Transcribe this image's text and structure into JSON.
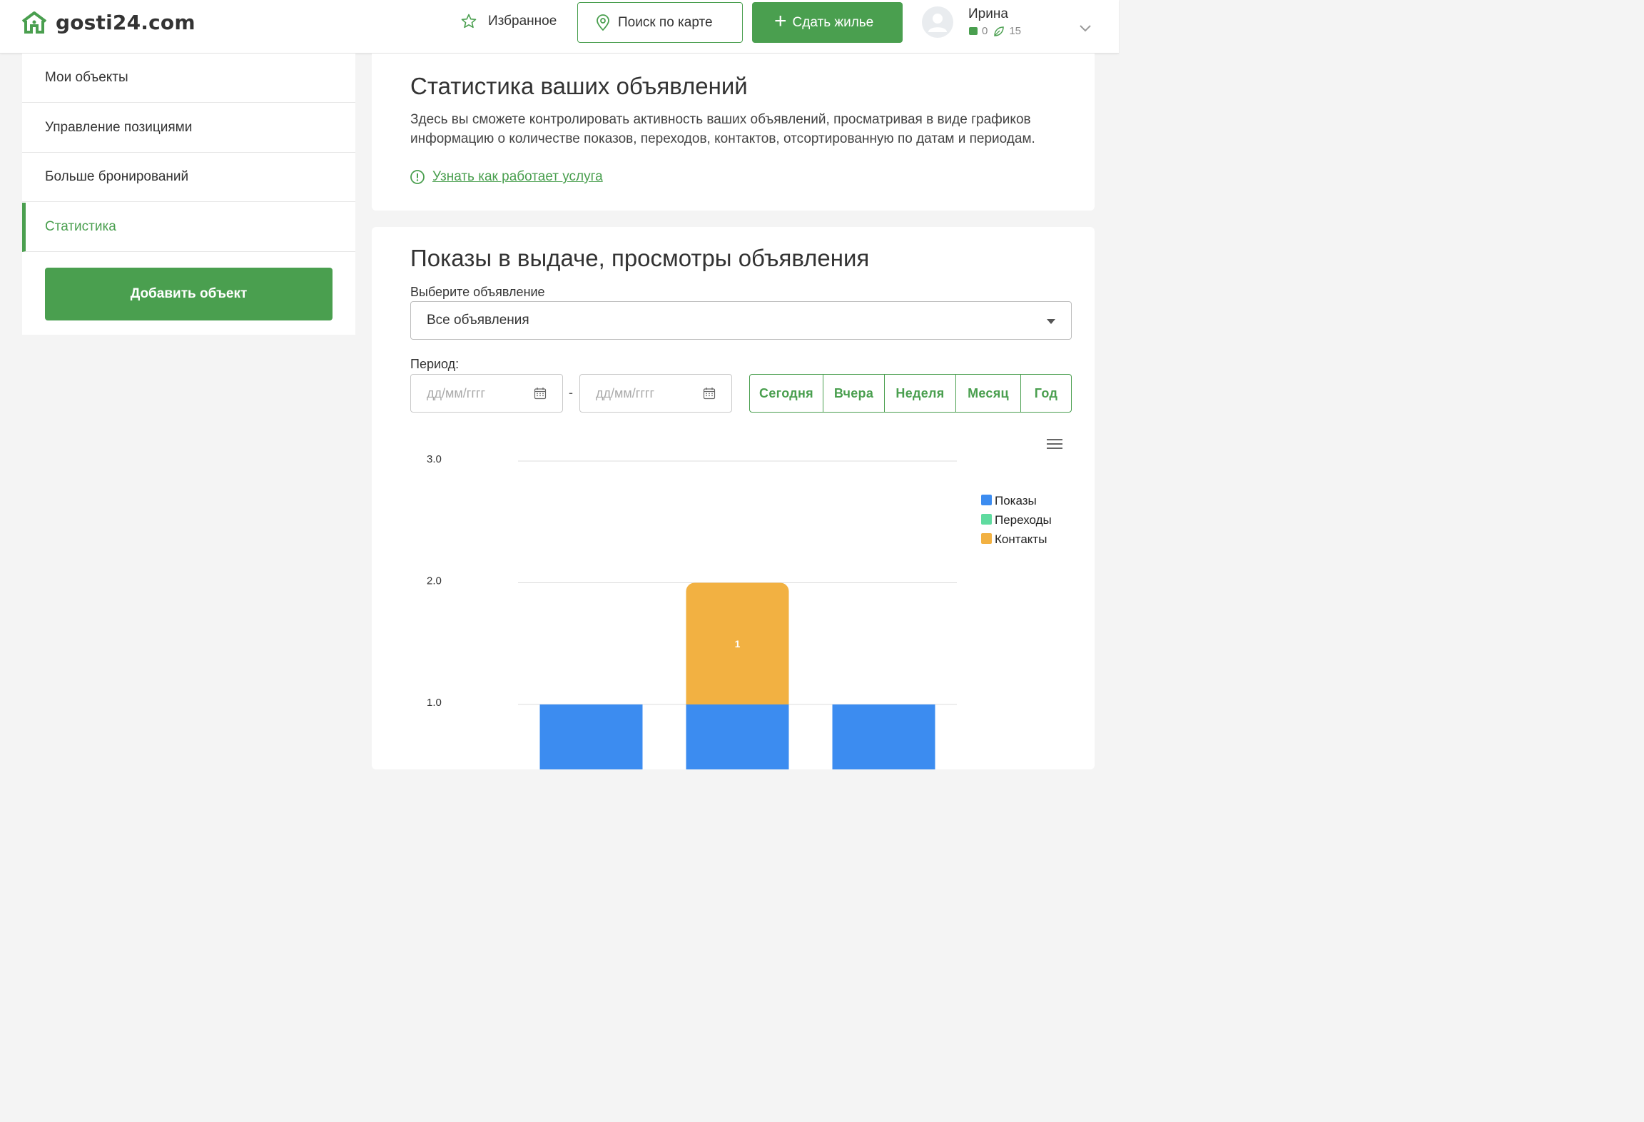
{
  "header": {
    "logo_text": "gosti24.com",
    "favorites_label": "Избранное",
    "map_search_label": "Поиск по карте",
    "rent_out_label": "Сдать жилье",
    "user": {
      "name": "Ирина",
      "count_a": "0",
      "count_b": "15"
    }
  },
  "sidebar": {
    "items": [
      {
        "label": "Мои объекты"
      },
      {
        "label": "Управление позициями"
      },
      {
        "label": "Больше бронирований"
      },
      {
        "label": "Статистика",
        "active": true
      }
    ],
    "add_button": "Добавить объект"
  },
  "intro": {
    "title": "Статистика ваших объявлений",
    "description": "Здесь вы сможете контролировать активность ваших объявлений, просматривая в виде графиков информацию о количестве показов, переходов, контактов, отсортированную по датам и периодам.",
    "learn_link": "Узнать как работает услуга"
  },
  "stats": {
    "title": "Показы в выдаче, просмотры объявления",
    "select_label": "Выберите объявление",
    "select_value": "Все объявления",
    "period_label": "Период:",
    "date_placeholder_from": "дд/мм/гггг",
    "date_placeholder_to": "дд/мм/гггг",
    "date_separator": "-",
    "period_buttons": [
      "Сегодня",
      "Вчера",
      "Неделя",
      "Месяц",
      "Год"
    ]
  },
  "colors": {
    "brand_green": "#4a9f4f",
    "series_shows": "#3c8cf0",
    "series_clicks": "#5fdb9f",
    "series_contacts": "#f2b142"
  },
  "chart_data": {
    "type": "bar",
    "stacked": true,
    "categories": [
      "",
      "",
      ""
    ],
    "series": [
      {
        "name": "Показы",
        "color": "#3c8cf0",
        "values": [
          1,
          1,
          1
        ]
      },
      {
        "name": "Переходы",
        "color": "#5fdb9f",
        "values": [
          0,
          0,
          0
        ]
      },
      {
        "name": "Контакты",
        "color": "#f2b142",
        "values": [
          0,
          1,
          0
        ]
      }
    ],
    "data_labels": {
      "series": "Контакты",
      "values": [
        "",
        "1",
        ""
      ]
    },
    "y_ticks": [
      "1.0",
      "2.0",
      "3.0"
    ],
    "ylim": [
      0,
      3
    ],
    "grid": true,
    "legend_position": "right"
  }
}
